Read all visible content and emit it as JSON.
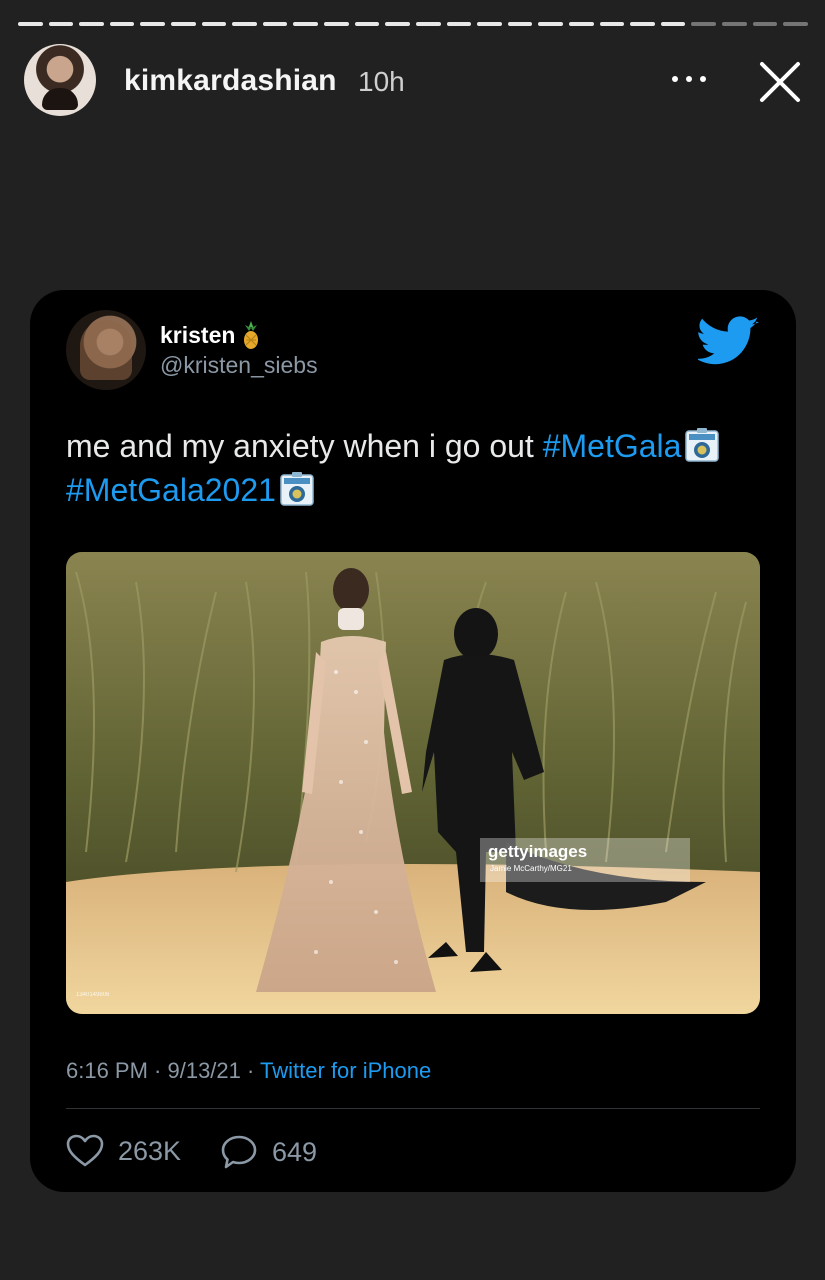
{
  "story": {
    "username": "kimkardashian",
    "time": "10h",
    "segments_total": 26,
    "segments_done": 22
  },
  "tweet": {
    "name": "kristen",
    "handle": "@kristen_siebs",
    "text": "me and my anxiety when i go out ",
    "hashtag1": "#MetGala",
    "hashtag2": "#MetGala2021",
    "photo": {
      "watermark": "gettyimages",
      "credit": "Jamie McCarthy/MG21",
      "image_id": "1340149806"
    },
    "meta_time": "6:16 PM · 9/13/21 · ",
    "source": "Twitter for iPhone",
    "likes": "263K",
    "replies": "649"
  },
  "colors": {
    "background": "#212121",
    "card": "#000000",
    "link": "#1d9bf0",
    "muted": "#8b98a5"
  }
}
